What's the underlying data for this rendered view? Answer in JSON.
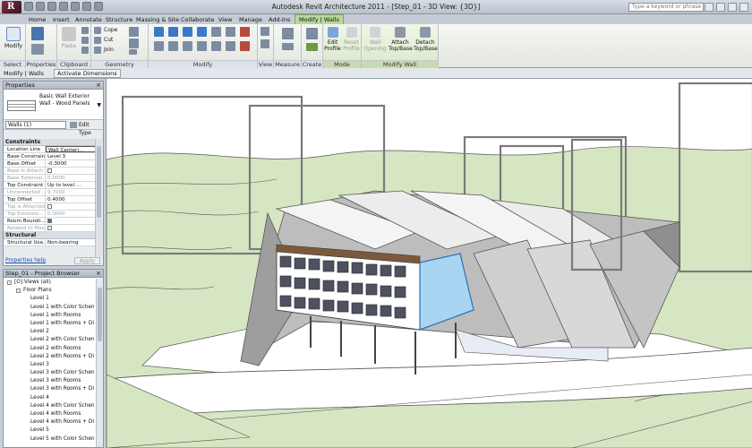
{
  "titlebar": {
    "title": "Autodesk Revit Architecture 2011 -  [Step_01 - 3D View: {3D}]",
    "search_placeholder": "Type a keyword or phrase"
  },
  "tabs": [
    "Home",
    "Insert",
    "Annotate",
    "Structure",
    "Massing & Site",
    "Collaborate",
    "View",
    "Manage",
    "Add-Ins",
    "Modify | Walls"
  ],
  "ribbon": {
    "select": {
      "modify_label": "Modify",
      "title": "Select"
    },
    "properties": {
      "title": "Properties"
    },
    "clipboard": {
      "paste_label": "Paste",
      "title": "Clipboard"
    },
    "geometry": {
      "cope_label": "Cope",
      "cut_label": "Cut",
      "join_label": "Join",
      "title": "Geometry"
    },
    "modify": {
      "title": "Modify"
    },
    "view": {
      "title": "View"
    },
    "measure": {
      "title": "Measure"
    },
    "create": {
      "title": "Create"
    },
    "mode": {
      "edit_profile_label": "Edit Profile",
      "reset_profile_label": "Reset Profile",
      "title": "Mode"
    },
    "modify_wall": {
      "wall_opening_label": "Wall Opening",
      "attach_label": "Attach Top/Base",
      "detach_label": "Detach Top/Base",
      "title": "Modify Wall"
    }
  },
  "options_bar": {
    "context": "Modify | Walls",
    "activate_dimensions": "Activate Dimensions"
  },
  "properties": {
    "title": "Properties",
    "type_name": "Basic Wall Exterior Wall - Wood Panels",
    "filter": "Walls (1)",
    "edit_type": "Edit Type",
    "groups": {
      "constraints": "Constraints",
      "structural": "Structural"
    },
    "rows": [
      {
        "name": "Location Line",
        "value": "Wall Centerl...",
        "state": "sel"
      },
      {
        "name": "Base Constraint",
        "value": "Level 3",
        "state": ""
      },
      {
        "name": "Base Offset",
        "value": "-0.3000",
        "state": ""
      },
      {
        "name": "Base is Attach...",
        "value": "",
        "state": "dim",
        "check": false
      },
      {
        "name": "Base Extensio...",
        "value": "0.0000",
        "state": "dim"
      },
      {
        "name": "Top Constraint",
        "value": "Up to level ...",
        "state": ""
      },
      {
        "name": "Unconnected ...",
        "value": "9.7000",
        "state": "dim"
      },
      {
        "name": "Top Offset",
        "value": "0.4000",
        "state": ""
      },
      {
        "name": "Top is Attached",
        "value": "",
        "state": "dim",
        "check": false
      },
      {
        "name": "Top Extensio...",
        "value": "0.0000",
        "state": "dim"
      },
      {
        "name": "Room Boundi...",
        "value": "",
        "state": "",
        "check": true
      },
      {
        "name": "Related to Mass",
        "value": "",
        "state": "dim",
        "check": false
      }
    ],
    "structural_rows": [
      {
        "name": "Structural Usa...",
        "value": "Non-bearing",
        "state": ""
      }
    ],
    "help": "Properties help",
    "apply": "Apply"
  },
  "browser": {
    "title": "Step_01 - Project Browser",
    "items": [
      {
        "label": "[O]  Views (all)",
        "indent": 0,
        "toggle": "-"
      },
      {
        "label": "Floor Plans",
        "indent": 1,
        "toggle": "-"
      },
      {
        "label": "Level 1",
        "indent": 2
      },
      {
        "label": "Level 1 with Color Schen",
        "indent": 2
      },
      {
        "label": "Level 1 with Rooms",
        "indent": 2
      },
      {
        "label": "Level 1 with Rooms + Di",
        "indent": 2
      },
      {
        "label": "Level 2",
        "indent": 2
      },
      {
        "label": "Level 2 with Color Schen",
        "indent": 2
      },
      {
        "label": "Level 2 with Rooms",
        "indent": 2
      },
      {
        "label": "Level 2 with Rooms + Di",
        "indent": 2
      },
      {
        "label": "Level 3",
        "indent": 2
      },
      {
        "label": "Level 3 with Color Schen",
        "indent": 2
      },
      {
        "label": "Level 3 with Rooms",
        "indent": 2
      },
      {
        "label": "Level 3 with Rooms + Di",
        "indent": 2
      },
      {
        "label": "Level 4",
        "indent": 2
      },
      {
        "label": "Level 4 with Color Schen",
        "indent": 2
      },
      {
        "label": "Level 4 with Rooms",
        "indent": 2
      },
      {
        "label": "Level 4 with Rooms + Di",
        "indent": 2
      },
      {
        "label": "Level 5",
        "indent": 2
      },
      {
        "label": "Level 5 with Color Schen",
        "indent": 2
      }
    ]
  },
  "colors": {
    "selection_blue": "#a9d4f2",
    "context_tab_green": "#b9d69b",
    "tree_gray": "#9a9a9a",
    "grass_green": "#d6e6c2"
  }
}
